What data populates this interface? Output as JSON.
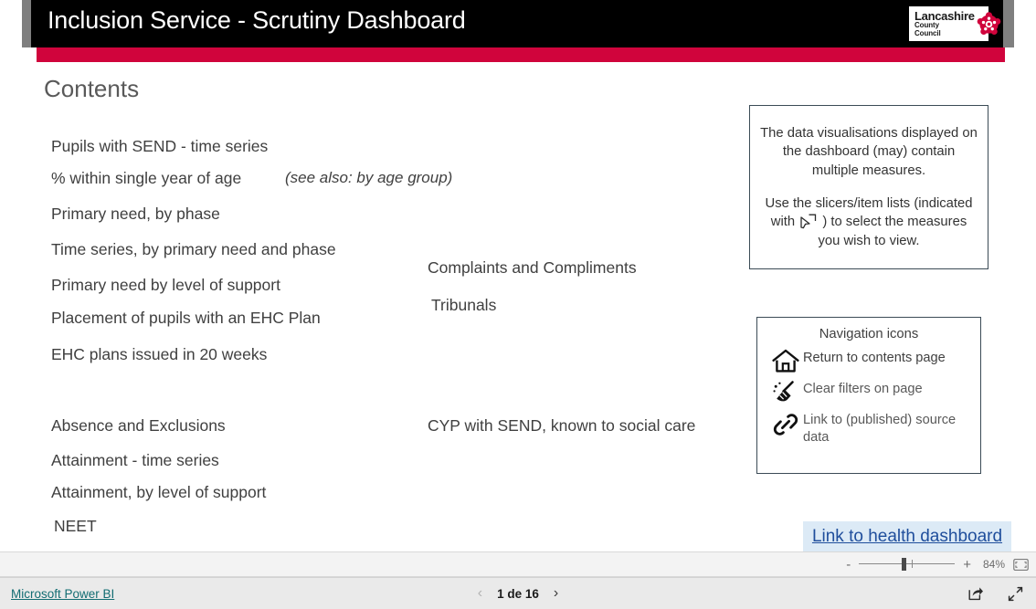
{
  "header": {
    "title": "Inclusion Service - Scrutiny Dashboard",
    "logo": {
      "line1": "Lancashire",
      "line2": "County",
      "line3": "Council",
      "rose_icon": "red-rose-icon"
    },
    "colors": {
      "bar_black": "#000000",
      "bar_red": "#d0043c",
      "bar_grey": "#7f7f7f",
      "logo_rose": "#d0043c"
    }
  },
  "contents": {
    "heading": "Contents",
    "column_left": [
      {
        "label": "Pupils with SEND - time series"
      },
      {
        "label": "% within single year of age",
        "note": "(see also: by age group)"
      },
      {
        "label": "Primary need, by phase"
      },
      {
        "label": "Time series, by primary need and phase"
      },
      {
        "label": "Primary need by level of support"
      },
      {
        "label": "Placement of pupils with an EHC Plan"
      },
      {
        "label": "EHC plans issued in 20 weeks"
      },
      {
        "label": "Absence and Exclusions"
      },
      {
        "label": "Attainment - time series"
      },
      {
        "label": "Attainment, by level of support"
      },
      {
        "label": "NEET"
      }
    ],
    "column_middle": [
      {
        "label": "Complaints and Compliments"
      },
      {
        "label": "Tribunals"
      },
      {
        "label": "CYP with SEND, known to social care"
      }
    ]
  },
  "info_box": {
    "paragraph_1": "The data visualisations displayed on the dashboard (may) contain multiple measures.",
    "paragraph_2_before": "Use the slicers/item lists (indicated with ",
    "paragraph_2_after": " ) to select the measures you wish to view.",
    "slicer_icon": "slicer-cursor-icon"
  },
  "navigation_box": {
    "title": "Navigation icons",
    "rows": [
      {
        "icon": "home-icon",
        "label": "Return to contents page"
      },
      {
        "icon": "broom-icon",
        "label": "Clear filters on page"
      },
      {
        "icon": "link-chain-icon",
        "label": "Link to (published) source data"
      }
    ]
  },
  "health_link": {
    "label": "Link to health dashboard",
    "highlight_color": "#dceaf6",
    "text_color": "#1f4e9c"
  },
  "zoom_control": {
    "minus": "-",
    "plus": "+",
    "percent": "84%",
    "fit_icon": "fit-to-page-icon"
  },
  "status_bar": {
    "brand": "Microsoft Power BI",
    "brand_color": "#136d73",
    "prev_icon": "chevron-left-icon",
    "next_icon": "chevron-right-icon",
    "page_label": "1 de 16",
    "share_icon": "share-icon",
    "fullscreen_icon": "fullscreen-icon"
  }
}
